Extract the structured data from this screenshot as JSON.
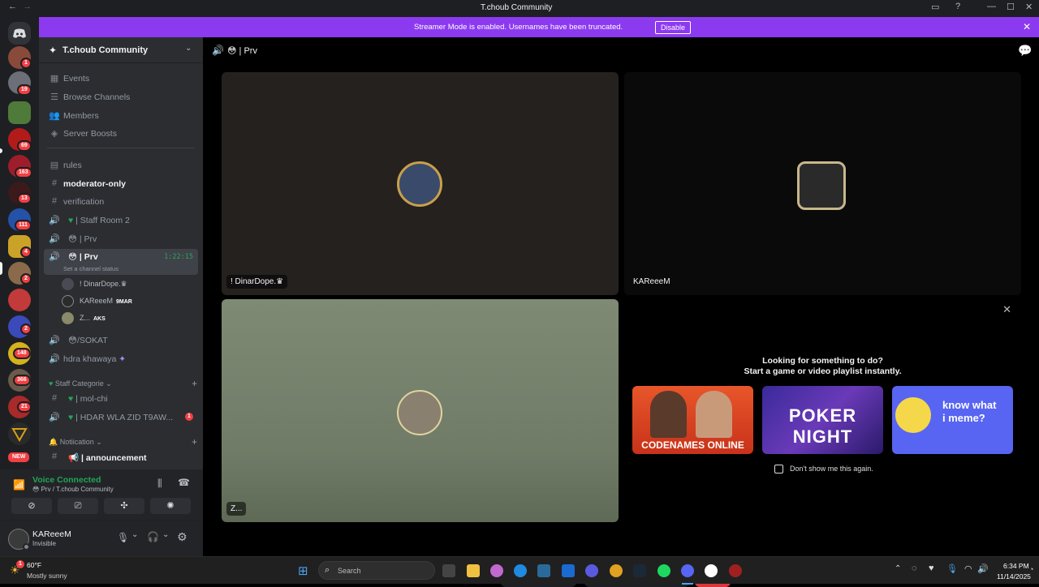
{
  "window": {
    "title": "T.choub Community"
  },
  "servers": {
    "badges": [
      "1",
      "19",
      "69",
      "163",
      "13",
      "111",
      "4",
      "2",
      "2",
      "148",
      "366",
      "21",
      "NEW"
    ]
  },
  "banner": {
    "message": "Streamer Mode is enabled. Usernames have been truncated.",
    "button": "Disable"
  },
  "guild": {
    "name": "T.choub Community"
  },
  "nav_items": [
    "Events",
    "Browse Channels",
    "Members",
    "Server Boosts"
  ],
  "channels": {
    "rules": "rules",
    "moderator": "moderator-only",
    "verification": "verification",
    "staff_room": "| Staff Room 2",
    "prv1": "| Prv",
    "prv2": "| Prv",
    "prv2_timer": "1:22:15",
    "prv2_status": "Set a channel status",
    "sokat": "/SOKAT",
    "hdra": "hdra khawaya",
    "cat_staff": "Staff Categorie",
    "mol_chi": "| mol-chi",
    "hdar": "| HDAR WLA ZID T9AW...",
    "hdar_badge": "1",
    "cat_notif": "Notiication",
    "announcement": "| announcement"
  },
  "voice_users": [
    {
      "name": "! DinarDope.♛",
      "tag": ""
    },
    {
      "name": "KAReeeM",
      "tag": "9MAR"
    },
    {
      "name": "Z...",
      "tag": "AKS"
    }
  ],
  "voice_panel": {
    "status": "Voice Connected",
    "channel": "Prv / T.choub Community"
  },
  "user": {
    "name": "KAReeeM",
    "status": "Invisible"
  },
  "header": {
    "channel": "| Prv"
  },
  "tiles": {
    "t1": "! DinarDope.♛",
    "t2": "KAReeeM",
    "t3": "Z..."
  },
  "activity": {
    "title1": "Looking for something to do?",
    "title2": "Start a game or video playlist instantly.",
    "games": [
      "CODENAMES ONLINE",
      "POKER NIGHT",
      "know what i meme?"
    ],
    "checkbox": "Don't show me this again."
  },
  "taskbar": {
    "temp": "60°F",
    "weather": "Mostly sunny",
    "search": "Search",
    "time": "6:34 PM",
    "date": "11/14/2025",
    "weather_badge": "1"
  },
  "colors": {
    "accent": "#8c3af0",
    "green": "#23a55a",
    "red": "#da373c",
    "blurple": "#5865f2"
  }
}
